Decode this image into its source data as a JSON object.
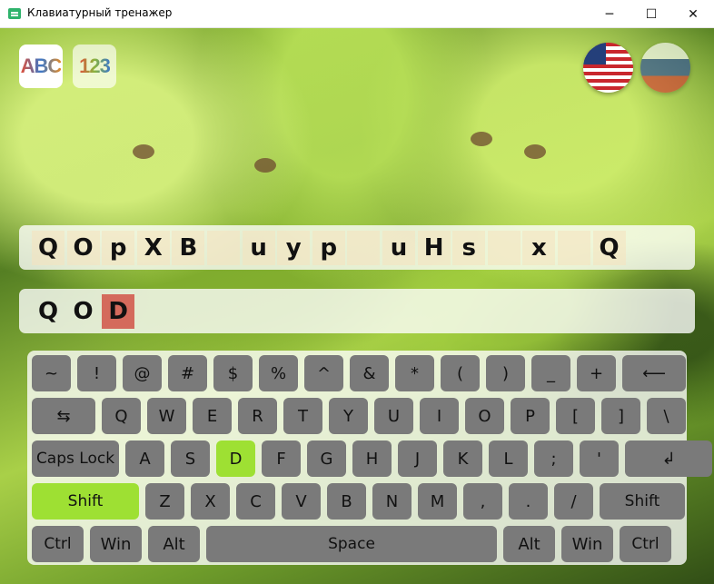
{
  "window": {
    "title": "Клавиатурный тренажер",
    "controls": {
      "minimize": "─",
      "maximize": "☐",
      "close": "✕"
    }
  },
  "modes": {
    "letters": "ABC",
    "digits": "123"
  },
  "languages": [
    "english-flag",
    "russian-flag"
  ],
  "target_text": [
    "Q",
    "O",
    "p",
    "X",
    "B",
    " ",
    "u",
    "y",
    "p",
    " ",
    "u",
    "H",
    "s",
    " ",
    "x",
    " ",
    "Q"
  ],
  "typed_text": [
    "Q",
    "O",
    "D"
  ],
  "error_index": 2,
  "keyboard": {
    "rows": [
      [
        "~",
        "!",
        "@",
        "#",
        "$",
        "%",
        "^",
        "&",
        "*",
        "(",
        ")",
        "_",
        "+",
        "⟵"
      ],
      [
        "⇆",
        "Q",
        "W",
        "E",
        "R",
        "T",
        "Y",
        "U",
        "I",
        "O",
        "P",
        "[",
        "]",
        "\\"
      ],
      [
        "Caps Lock",
        "A",
        "S",
        "D",
        "F",
        "G",
        "H",
        "J",
        "K",
        "L",
        ";",
        "'",
        "↲"
      ],
      [
        "Shift",
        "Z",
        "X",
        "C",
        "V",
        "B",
        "N",
        "M",
        ",",
        ".",
        "/",
        "Shift"
      ],
      [
        "Ctrl",
        "Win",
        "Alt",
        "Space",
        "Alt",
        "Win",
        "Ctrl"
      ]
    ],
    "highlighted": [
      "D",
      "Shift-left"
    ]
  },
  "colors": {
    "highlight": "#9ee033",
    "error": "#d46a5c",
    "key": "#7a7a7a"
  }
}
